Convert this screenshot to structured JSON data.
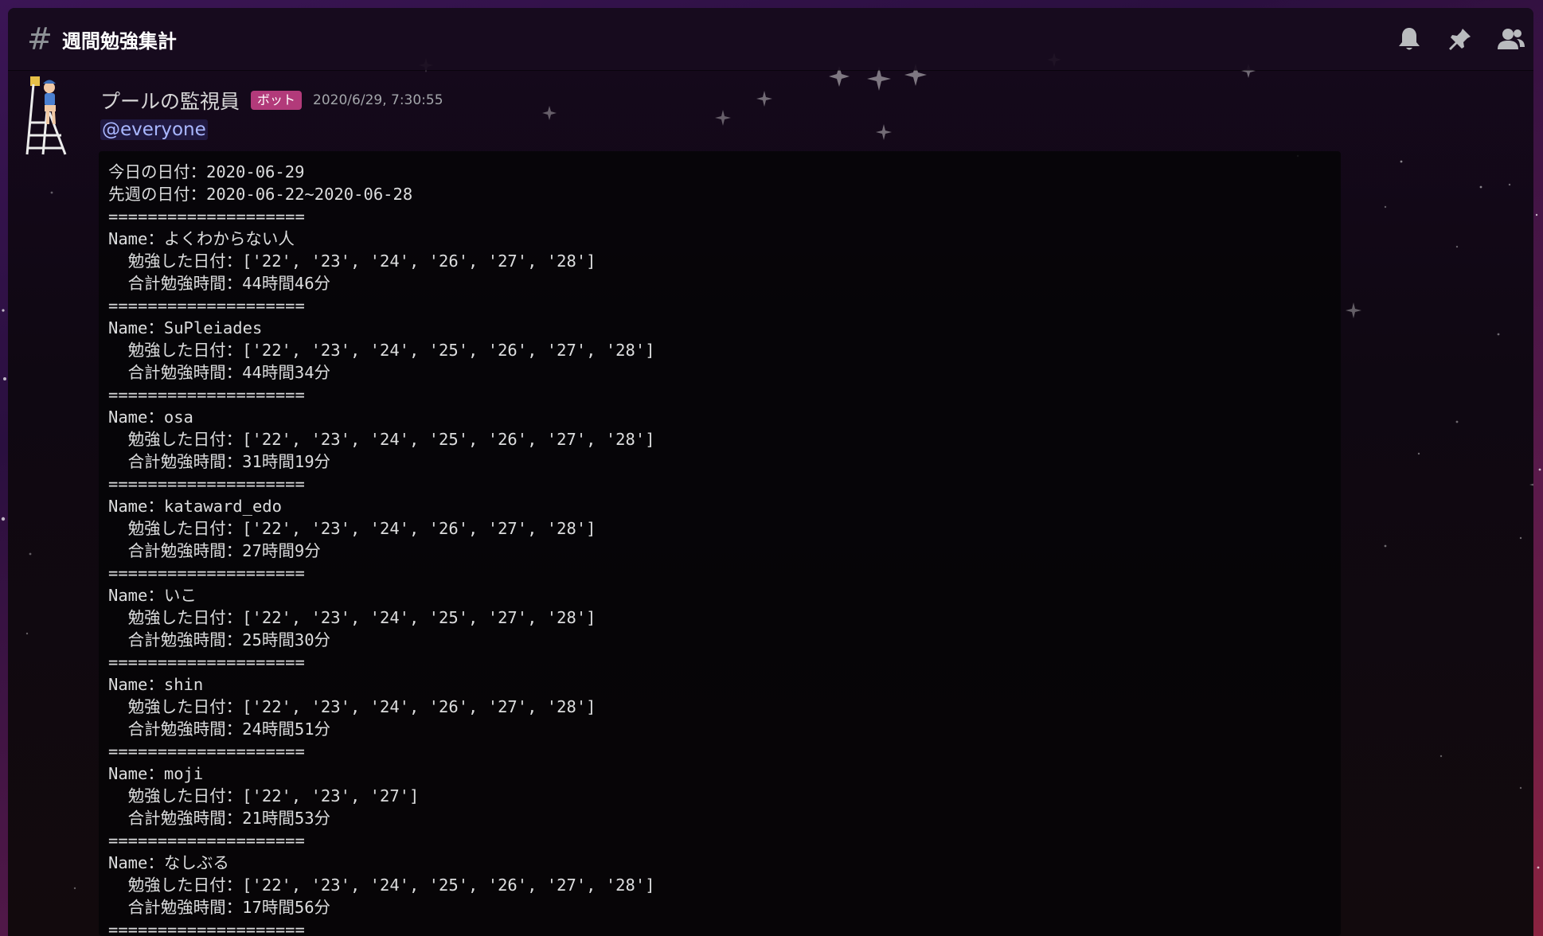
{
  "header": {
    "hash_symbol": "#",
    "channel_name": "週間勉強集計",
    "icons": [
      "bell-icon",
      "pin-icon",
      "members-icon"
    ]
  },
  "message": {
    "avatar_icon": "lifeguard-avatar-icon",
    "username": "プールの監視員",
    "bot_tag": "ボット",
    "timestamp": "2020/6/29, 7:30:55",
    "mention": "@everyone",
    "code_lines": [
      "今日の日付：2020-06-29",
      "先週の日付：2020-06-22~2020-06-28",
      "====================",
      "Name：よくわからない人",
      "  勉強した日付：['22', '23', '24', '26', '27', '28']",
      "  合計勉強時間：44時間46分",
      "====================",
      "Name：SuPleiades",
      "  勉強した日付：['22', '23', '24', '25', '26', '27', '28']",
      "  合計勉強時間：44時間34分",
      "====================",
      "Name：osa",
      "  勉強した日付：['22', '23', '24', '25', '26', '27', '28']",
      "  合計勉強時間：31時間19分",
      "====================",
      "Name：kataward_edo",
      "  勉強した日付：['22', '23', '24', '26', '27', '28']",
      "  合計勉強時間：27時間9分",
      "====================",
      "Name：いこ",
      "  勉強した日付：['22', '23', '24', '25', '27', '28']",
      "  合計勉強時間：25時間30分",
      "====================",
      "Name：shin",
      "  勉強した日付：['22', '23', '24', '26', '27', '28']",
      "  合計勉強時間：24時間51分",
      "====================",
      "Name：moji",
      "  勉強した日付：['22', '23', '27']",
      "  合計勉強時間：21時間53分",
      "====================",
      "Name：なしぶる",
      "  勉強した日付：['22', '23', '24', '25', '26', '27', '28']",
      "  合計勉強時間：17時間56分",
      "===================="
    ]
  },
  "colors": {
    "background_gradient_start": "#3b1555",
    "background_gradient_end": "#8a2340",
    "bot_tag": "#b23a7a",
    "mention": "#a9b7ff",
    "code_text": "#dcddde"
  }
}
